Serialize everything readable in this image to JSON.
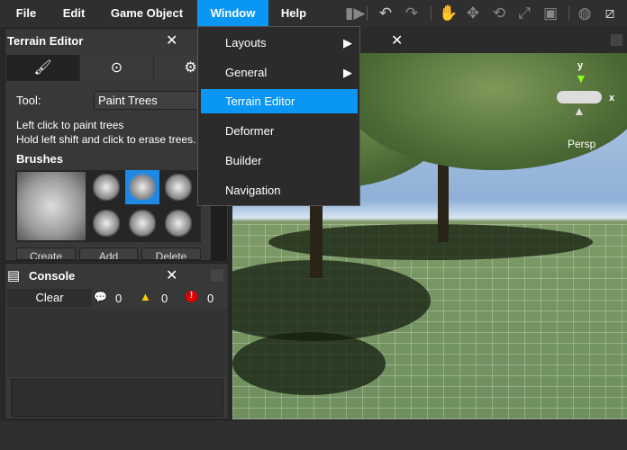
{
  "menubar": {
    "items": [
      "File",
      "Edit",
      "Game Object",
      "Window",
      "Help"
    ],
    "active": "Window"
  },
  "toolbar": {
    "icons": [
      "play-step-icon",
      "undo-icon",
      "redo-icon",
      "hand-icon",
      "move-icon",
      "rotate-icon",
      "scale-icon",
      "rect-icon",
      "globe-icon",
      "pivot-icon"
    ]
  },
  "terrain_editor": {
    "title": "Terrain Editor",
    "tool_label": "Tool:",
    "tool_value": "Paint Trees",
    "help1": "Left click to paint trees",
    "help2": "Hold left shift and click to erase trees.",
    "brushes_label": "Brushes",
    "buttons": [
      "Create",
      "Add",
      "Delete"
    ]
  },
  "console": {
    "title": "Console",
    "clear": "Clear",
    "info_count": "0",
    "warning_count": "0",
    "error_count": "0"
  },
  "scene": {
    "gizmo_y": "y",
    "gizmo_x": "x",
    "projection": "Persp"
  },
  "window_menu": {
    "items": [
      {
        "label": "Layouts",
        "submenu": true
      },
      {
        "label": "General",
        "submenu": true
      },
      {
        "label": "Terrain Editor",
        "highlighted": true
      },
      {
        "label": "Deformer"
      },
      {
        "label": "Builder"
      },
      {
        "label": "Navigation"
      }
    ]
  },
  "colors": {
    "accent": "#0a96f5",
    "warning": "#f5d000",
    "error": "#e00000"
  }
}
